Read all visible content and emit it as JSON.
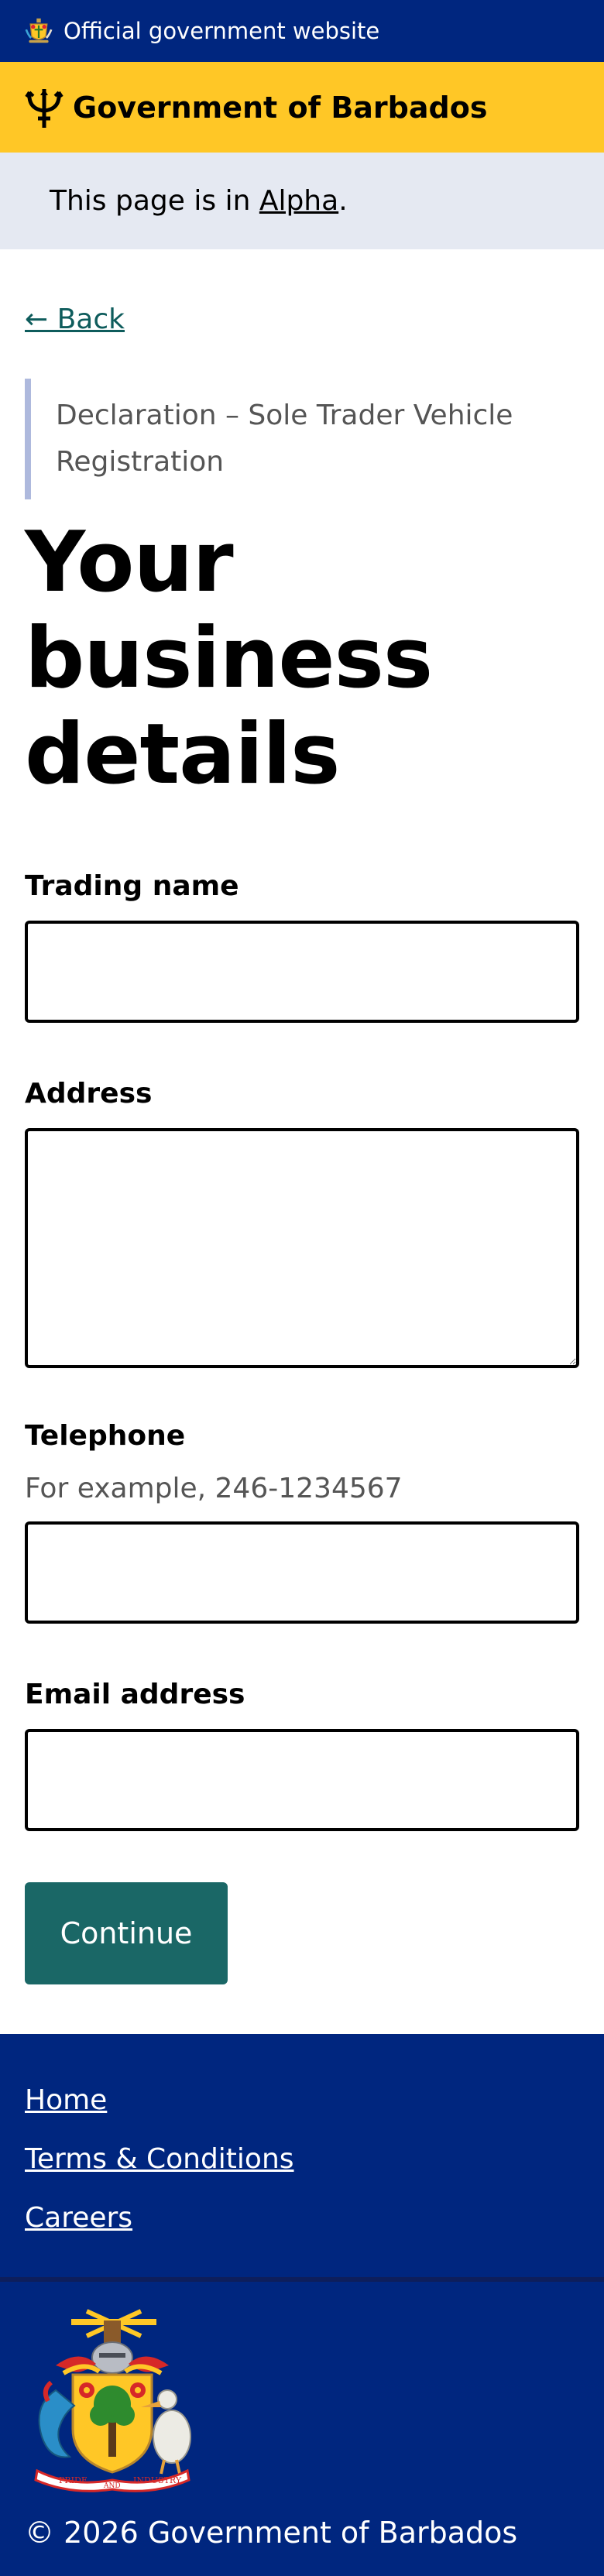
{
  "official_banner": {
    "text": "Official government website"
  },
  "brand": {
    "title": "Government of Barbados"
  },
  "phase_banner": {
    "prefix": "This page is in ",
    "phase": "Alpha",
    "suffix": "."
  },
  "back_link": "← Back",
  "caption": "Declaration – Sole Trader Vehicle Registration",
  "heading": "Your business details",
  "form": {
    "trading_name": {
      "label": "Trading name",
      "value": ""
    },
    "address": {
      "label": "Address",
      "value": ""
    },
    "telephone": {
      "label": "Telephone",
      "hint": "For example, 246-1234567",
      "value": ""
    },
    "email": {
      "label": "Email address",
      "value": ""
    },
    "submit_label": "Continue"
  },
  "footer": {
    "links": [
      {
        "label": "Home"
      },
      {
        "label": "Terms & Conditions"
      },
      {
        "label": "Careers"
      }
    ],
    "coat_of_arms_motto": [
      "PRIDE",
      "AND",
      "INDUSTRY"
    ],
    "copyright": "© 2026 Government of Barbados"
  },
  "colors": {
    "official_bar": "#00267f",
    "brand_bar": "#ffc726",
    "phase_bar": "#e5e9f2",
    "link": "#0e5c5c",
    "button": "#1a6766",
    "footer": "#00267f"
  },
  "icons": {
    "official_bar": "barbados-crest-icon",
    "brand": "trident-icon",
    "footer": "coat-of-arms"
  }
}
